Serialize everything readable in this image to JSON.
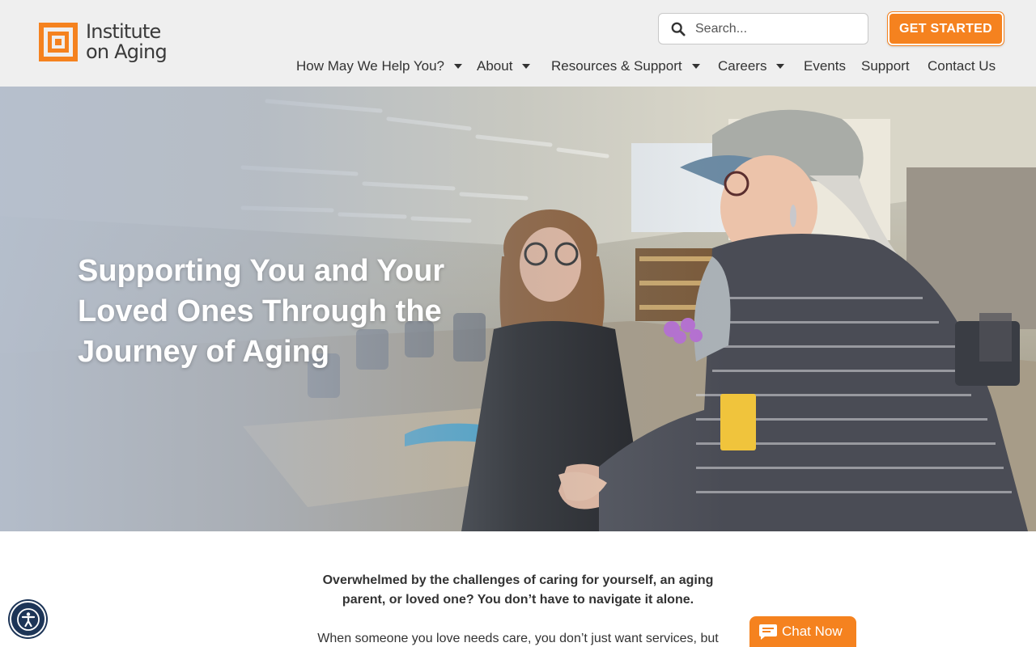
{
  "brand": {
    "logo_line1": "Institute",
    "logo_line2": "on Aging",
    "accent": "#f5821f",
    "dark": "#1d3557"
  },
  "header": {
    "search_placeholder": "Search...",
    "cta_label": "GET STARTED"
  },
  "nav": {
    "items": [
      {
        "label": "How May We Help You?",
        "has_dropdown": true
      },
      {
        "label": "About",
        "has_dropdown": true
      },
      {
        "label": "Resources & Support",
        "has_dropdown": true
      },
      {
        "label": "Careers",
        "has_dropdown": true
      },
      {
        "label": "Events",
        "has_dropdown": false
      },
      {
        "label": "Support",
        "has_dropdown": false
      },
      {
        "label": "Contact Us",
        "has_dropdown": false
      }
    ]
  },
  "hero": {
    "title": "Supporting You and Your Loved Ones Through the Journey of Aging"
  },
  "intro": {
    "lead": "Overwhelmed by the challenges of caring for yourself, an aging parent, or loved one? You don’t have to navigate it alone.",
    "body": "When someone you love needs care, you don’t just want services, but"
  },
  "widgets": {
    "chat_label": "Chat Now",
    "accessibility_icon": "accessibility-icon"
  }
}
